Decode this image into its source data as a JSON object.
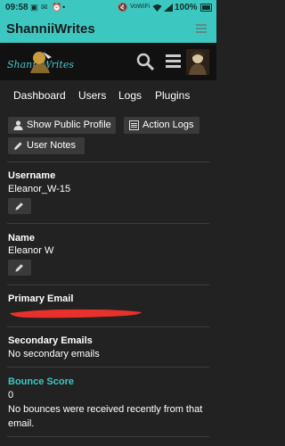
{
  "status_bar": {
    "time": "09:58",
    "battery_pct": "100%",
    "icons": [
      "gallery-icon",
      "mail-icon",
      "alarm-icon",
      "mute-icon",
      "vowifi-icon",
      "wifi-icon",
      "signal-icon",
      "battery-icon"
    ]
  },
  "app_bar": {
    "title": "ShanniiWrites",
    "accent": "#3cc7c0"
  },
  "site_header": {
    "logo_text": "Shann Writes"
  },
  "nav": {
    "tabs": [
      "Dashboard",
      "Users",
      "Logs",
      "Plugins"
    ]
  },
  "actions": {
    "show_public_profile": "Show Public Profile",
    "action_logs": "Action Logs",
    "user_notes": "User Notes"
  },
  "fields": {
    "username_label": "Username",
    "username_value": "Eleanor_W-15",
    "name_label": "Name",
    "name_value": "Eleanor W",
    "primary_email_label": "Primary Email",
    "secondary_emails_label": "Secondary Emails",
    "secondary_emails_value": "No secondary emails",
    "bounce_score_label": "Bounce Score",
    "bounce_score_value": "0",
    "bounce_text": "No bounces were received recently from that email."
  }
}
